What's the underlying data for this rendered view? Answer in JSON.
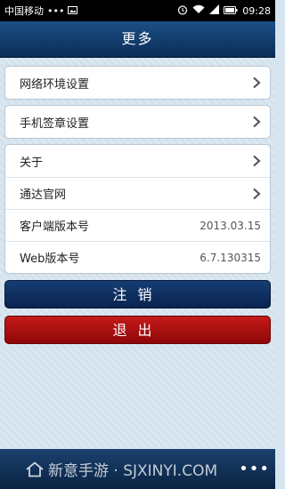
{
  "status_bar": {
    "carrier": "中国移动",
    "dots": "•••",
    "time": "09:28"
  },
  "header": {
    "title": "更多"
  },
  "menu": {
    "network": "网络环境设置",
    "signature": "手机签章设置",
    "about": "关于",
    "website": "通达官网",
    "client_version_label": "客户端版本号",
    "client_version_value": "2013.03.15",
    "web_version_label": "Web版本号",
    "web_version_value": "6.7.130315"
  },
  "buttons": {
    "logout": "注销",
    "exit": "退出"
  },
  "bottom": {
    "watermark": "新意手游 · SJXINYI.COM",
    "more": "•••"
  },
  "colors": {
    "header": "#1b4f86",
    "logout_button": "#163d73",
    "exit_button": "#c51a1a"
  }
}
